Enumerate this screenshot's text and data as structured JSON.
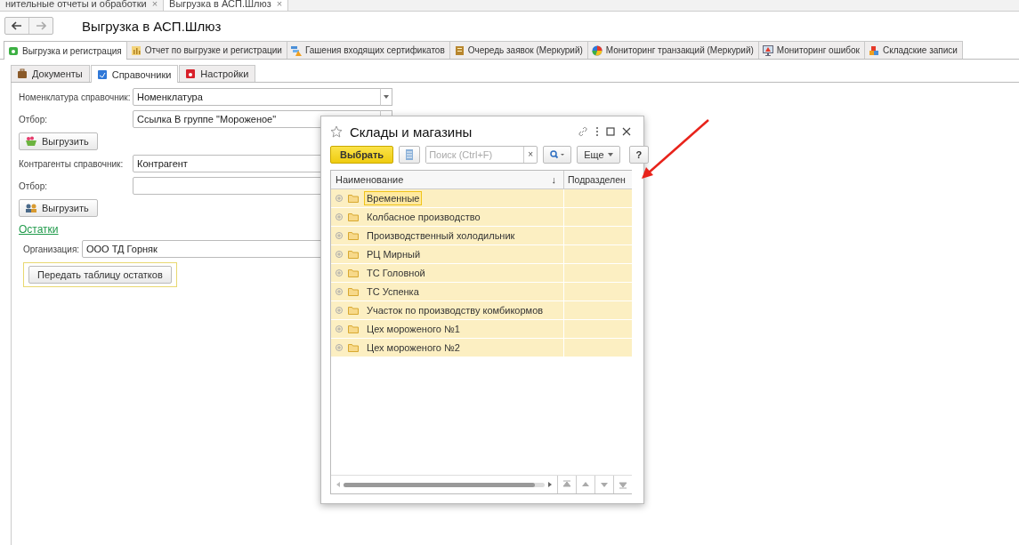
{
  "open_tabs": [
    {
      "label": "нительные отчеты и обработки",
      "close": "×",
      "selected": false
    },
    {
      "label": "Выгрузка в АСП.Шлюз",
      "close": "×",
      "selected": true
    }
  ],
  "page": {
    "title": "Выгрузка в АСП.Шлюз"
  },
  "main_tabs": [
    {
      "label": "Выгрузка и регистрация",
      "selected": true
    },
    {
      "label": "Отчет по выгрузке и регистрации",
      "selected": false
    },
    {
      "label": "Гашения входящих сертификатов",
      "selected": false
    },
    {
      "label": "Очередь заявок (Меркурий)",
      "selected": false
    },
    {
      "label": "Мониторинг транзакций (Меркурий)",
      "selected": false
    },
    {
      "label": "Мониторинг ошибок",
      "selected": false
    },
    {
      "label": "Складские записи",
      "selected": false
    }
  ],
  "sub_tabs": [
    {
      "label": "Документы",
      "selected": false
    },
    {
      "label": "Справочники",
      "selected": true
    },
    {
      "label": "Настройки",
      "selected": false
    }
  ],
  "form": {
    "rows": [
      {
        "kind": "field",
        "label": "Номенклатура справочник:",
        "value": "Номенклатура",
        "dropdown": true
      },
      {
        "kind": "field",
        "label": "Отбор:",
        "value": "Ссылка В группе \"Мороженое\"",
        "choice": true
      },
      {
        "kind": "button",
        "label": "Выгрузить",
        "focused": false
      },
      {
        "kind": "field",
        "label": "Контрагенты справочник:",
        "value": "Контрагент"
      },
      {
        "kind": "field",
        "label": "Отбор:"
      },
      {
        "kind": "button",
        "label": "Выгрузить",
        "focused": false
      },
      {
        "kind": "link",
        "label": "Остатки"
      },
      {
        "kind": "field",
        "label": "Организация:",
        "value": "ООО ТД Горняк",
        "indent": true
      },
      {
        "kind": "button",
        "label": "Передать таблицу остатков",
        "focused": true
      }
    ]
  },
  "dialog": {
    "title": "Склады и магазины",
    "select_button": "Выбрать",
    "search": {
      "placeholder": "Поиск (Ctrl+F)",
      "clear": "×"
    },
    "more_button": "Еще",
    "help_button": "?",
    "columns": [
      {
        "label": "Наименование",
        "sort": "↓"
      },
      {
        "label": "Подразделен"
      }
    ],
    "rows": [
      {
        "name": "Временные",
        "selected": true
      },
      {
        "name": "Колбасное производство",
        "selected": false
      },
      {
        "name": "Производственный холодильник",
        "selected": false
      },
      {
        "name": "РЦ Мирный",
        "selected": false
      },
      {
        "name": "ТС Головной",
        "selected": false
      },
      {
        "name": "ТС Успенка",
        "selected": false
      },
      {
        "name": "Участок по производству комбикормов",
        "selected": false
      },
      {
        "name": "Цех мороженого №1",
        "selected": false
      },
      {
        "name": "Цех мороженого №2",
        "selected": false
      }
    ]
  }
}
